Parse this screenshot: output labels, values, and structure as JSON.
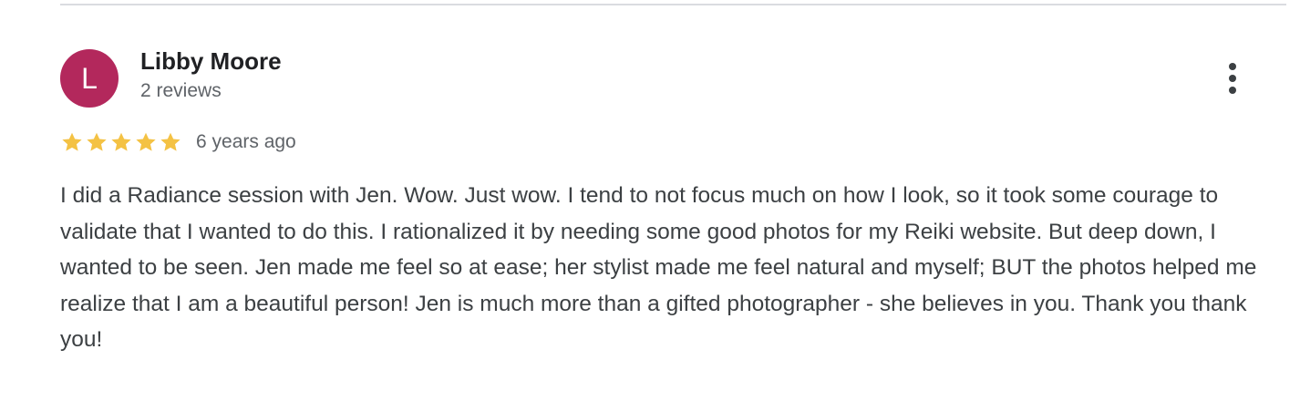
{
  "review": {
    "avatar_initial": "L",
    "reviewer_name": "Libby Moore",
    "review_count": "2 reviews",
    "rating": 5,
    "rating_max": 5,
    "time_ago": "6 years ago",
    "text": "I did a Radiance session with Jen. Wow. Just wow. I tend to not focus much on how I look, so it took some courage to validate that I wanted to do this. I rationalized it by needing some good photos for my Reiki website. But deep down, I wanted to be seen. Jen made me feel so at ease; her stylist made me feel natural and myself; BUT the photos helped me realize that I am a beautiful person! Jen is much more than a gifted photographer - she believes in you. Thank you thank you!"
  },
  "colors": {
    "avatar_background": "#b3285c",
    "star_filled": "#f4c244",
    "divider": "#dadce0"
  },
  "icons": {
    "more_menu": "more-vert-icon",
    "star": "star-icon"
  }
}
